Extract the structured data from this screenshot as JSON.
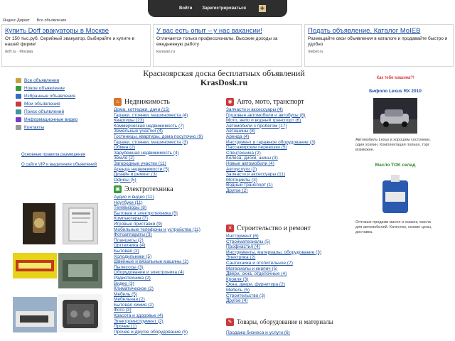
{
  "topbar": {
    "login": "Войти",
    "register": "Зарегистрироваться",
    "icon": "bookmark-icon"
  },
  "yandex": {
    "label1": "Яндекс.Директ",
    "label2": "Все объявления"
  },
  "ads": [
    {
      "title": "Купить Doff эвакуаторы в Москве",
      "text": "От 150 тыс.руб. Серийный эвакуатор. Выбирайте и купите в нашей фирме!",
      "url": "doff.ru · Москва"
    },
    {
      "title": "У вас есть опыт – у нас вакансии!",
      "text": "Отличается только профессионалы. Высокие доходы за ежедневную работу",
      "url": "karavan.ru"
    },
    {
      "title": "Подать объявление. Каталог MoIEB",
      "text": "Размещайте свои объявления в каталоге и продавайте быстро и удобно",
      "url": "mebel.ru"
    }
  ],
  "title": {
    "line1": "Красноярская доска бесплатных объявлений",
    "line2": "KrasDosk.ru"
  },
  "leftmenu": [
    {
      "label": "Все объявления",
      "color": "#c9a23a"
    },
    {
      "label": "Новое объявление",
      "color": "#3a9a3a"
    },
    {
      "label": "Избранные объявления",
      "color": "#3a6ac9"
    },
    {
      "label": "Мои объявления",
      "color": "#c93a3a"
    },
    {
      "label": "Поиск объявлений",
      "color": "#3a9a9a"
    },
    {
      "label": "Информационные видео",
      "color": "#7a3ac9"
    },
    {
      "label": "Контакты",
      "color": "#9a9a9a"
    }
  ],
  "leftlinks": [
    "Основные правила размещения",
    "О сайте VIP и выделение объявлений"
  ],
  "categories": [
    {
      "title": "Недвижимость",
      "icon": "house-icon",
      "color": "#d9742a",
      "items": [
        "Дома, коттеджи, дачи (15)",
        "Гаражи, стоянки, машиноместа (4)",
        "Квартиры (23)",
        "Коммерческая недвижимость (7)",
        "Земельные участки (4)",
        "Гостиницы, квартиры, дома посуточно (9)",
        "Гаражи, стоянки, машиноместа (3)",
        "Обмен (2)",
        "Зарубежная недвижимость (4)",
        "Земля (2)",
        "Загородные участки (11)",
        "Аренда недвижимости (5)",
        "Дизайн и ремонт (3)",
        "Офисы (5)"
      ]
    },
    {
      "title": "Авто, мото, транспорт",
      "icon": "car-icon",
      "color": "#c93a3a",
      "items": [
        "Запчасти и аксессуары (4)",
        "Грузовые автомобили и автобусы (8)",
        "Мото, вело и водный транспорт (6)",
        "Автомобили с пробегом (17)",
        "Автошины (8)",
        "Аренда (4)",
        "Инструмент и гаражное оборудование (3)",
        "Пассажирские перевозки (5)",
        "Спецтехника (2)",
        "Колеса, диски, шины (3)",
        "Новые автомобили (4)",
        "Автоуслуги (2)",
        "Запчасти и аксессуары (11)",
        "Мотоциклы (3)",
        "Водный транспорт (1)",
        "Другое (2)"
      ]
    },
    {
      "title": "Электротехника",
      "icon": "tv-icon",
      "color": "#3a9a3a",
      "items": [
        "Аудио и видео (11)",
        "Ноутбуки (11)",
        "Телевизоры (8)",
        "Бытовая и электротехника (5)",
        "Компьютеры (7)",
        "Игровые приставки (9)",
        "Мобильные телефоны и устройства (11)",
        "Фотоаппараты (3)",
        "Планшеты (2)",
        "Оргтехника (4)",
        "Бытовая (2)",
        "Холодильники (5)",
        "Швейные и вязальные машины (2)",
        "Пылесосы (3)",
        "Оборудование и электроника (4)",
        "Радиотехника (2)",
        "Видео (3)",
        "Климатическое (2)",
        "Мебель (5)",
        "Мебельная (2)",
        "Бытовая химия (2)",
        "Фото (3)",
        "Красота и здоровье (4)",
        "Электроинструмент (2)",
        "Прочее (1)",
        "Прочее и другое оборудование (5)"
      ]
    },
    {
      "title": "Строительство и ремонт",
      "icon": "tools-icon",
      "color": "#c93a3a",
      "items": [
        "Инструмент (6)",
        "Стройматериалы (5)",
        "Профнастил (4)",
        "Инструменты, материалы, оборудование (3)",
        "Электрика (2)",
        "Сантехника и отопительное (7)",
        "Материалы и кирпич (5)",
        "Двери, окна, отделочные (4)",
        "Кровля (3)",
        "Окна, двери, фурнитура (2)",
        "Мебель (5)",
        "Строительство (3)",
        "Другое (4)"
      ]
    },
    {
      "title": "Товары, оборудование и материалы",
      "icon": "box-icon",
      "color": "#c93a3a",
      "items": [
        "Продажа бизнеса и услуги (6)"
      ]
    }
  ],
  "right": {
    "red_label": "Как тебе машина?!",
    "car_title": "Бифоло Lexus RX 2010",
    "car_desc": "Автомобиль Lexus в хорошем состоянии, один хозяин. Комплектация полная, торг возможен.",
    "oil_title": "Масло TOK склад",
    "oil_desc": "Оптовые продажи масел и смазок, масла для автомобилей. Качество, низкие цены, доставка."
  },
  "colors": {
    "link": "#1a4fa0",
    "topbar": "#2e2e2e"
  }
}
